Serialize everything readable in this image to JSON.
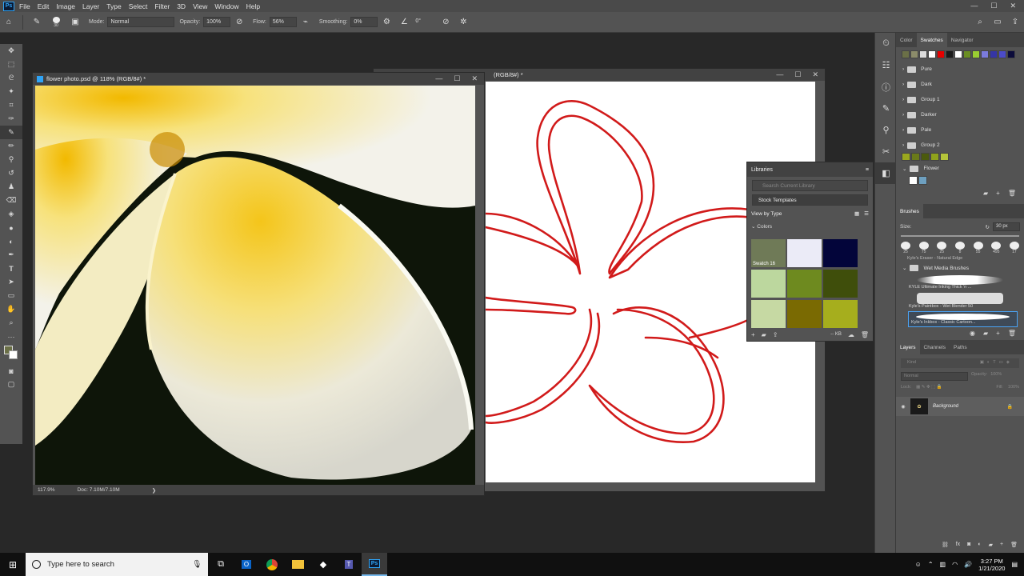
{
  "app": {
    "logo": "Ps"
  },
  "menu": [
    "File",
    "Edit",
    "Image",
    "Layer",
    "Type",
    "Select",
    "Filter",
    "3D",
    "View",
    "Window",
    "Help"
  ],
  "window_controls": {
    "minimize": "—",
    "maximize": "☐",
    "close": "✕"
  },
  "options": {
    "brush_size": "30",
    "mode_label": "Mode:",
    "mode_value": "Normal",
    "opacity_label": "Opacity:",
    "opacity_value": "100%",
    "flow_label": "Flow:",
    "flow_value": "56%",
    "smoothing_label": "Smoothing:",
    "smoothing_value": "0%",
    "angle_value": "0°"
  },
  "doc1": {
    "title": "flower photo.psd @ 118% (RGB/8#) *",
    "zoom": "117.9%",
    "doc_info": "Doc: 7.10M/7.10M"
  },
  "doc2": {
    "title": "(RGB/8#) *"
  },
  "libraries": {
    "title": "Libraries",
    "search_placeholder": "Search Current Library",
    "library_name": "Stock Templates",
    "view_by": "View by Type",
    "colors_header": "Colors",
    "swatch_label": "Swatch 16",
    "size_label": "-- KB",
    "swatches": [
      "#6f7a57",
      "#ebebf7",
      "#03053a",
      "#bcd79e",
      "#6e8a1f",
      "#3f4e0b",
      "#c6d9a3",
      "#7a6a02",
      "#a6ae1d"
    ]
  },
  "swatches_panel": {
    "tabs": [
      "Color",
      "Swatches",
      "Navigator"
    ],
    "recent": [
      "#6b7047",
      "#8c8c6a",
      "#dcdcdc",
      "#ffffff",
      "#e60000",
      "#1a1a1a",
      "#ffffff",
      "#6b8e23",
      "#9acd32",
      "#7b7bdc",
      "#3535a5",
      "#4b4bc8",
      "#0b0b3a"
    ],
    "groups": [
      "Pure",
      "Dark",
      "Group 1",
      "Darker",
      "Pale",
      "Group 2"
    ],
    "group2_colors": [
      "#9aa81e",
      "#6a7a1a",
      "#4b5a0d",
      "#8fa31c",
      "#b5c53a"
    ],
    "flower_group": "Flower",
    "flower_colors": [
      "#ffffff",
      "#6ea0c0"
    ]
  },
  "brushes": {
    "title": "Brushes",
    "size_label": "Size:",
    "size_value": "30 px",
    "tip_sizes": [
      "25",
      "75",
      "25",
      "8",
      "55",
      "495",
      "17"
    ],
    "prev_brush": "Kyle's Eraser - Natural Edge",
    "group": "Wet Media Brushes",
    "items": [
      "KYLE Ultimate Inking Thick 'n ...",
      "Kyle's Paintbox - Wet Blender 50",
      "Kyle's Inkbox - Classic Cartoon..."
    ]
  },
  "layers": {
    "tabs": [
      "Layers",
      "Channels",
      "Paths"
    ],
    "kind_label": "Kind",
    "blend_mode": "Normal",
    "opacity_label": "Opacity:",
    "opacity_value": "100%",
    "lock_label": "Lock:",
    "fill_label": "Fill:",
    "fill_value": "100%",
    "layer_name": "Background"
  },
  "taskbar": {
    "search_placeholder": "Type here to search",
    "time": "3:27 PM",
    "date": "1/21/2020"
  }
}
